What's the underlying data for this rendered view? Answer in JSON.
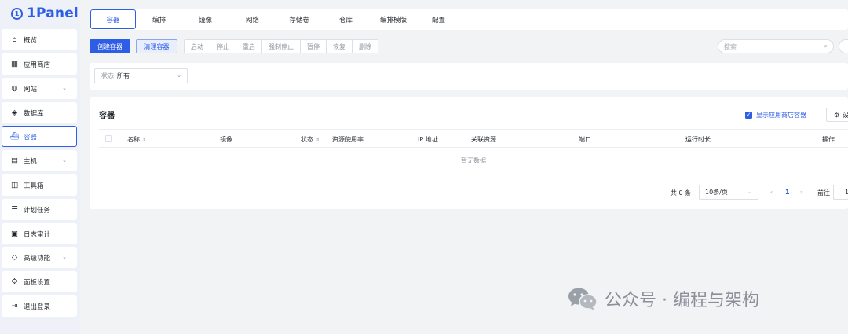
{
  "app": {
    "name": "1Panel"
  },
  "sidebar": {
    "items": [
      {
        "label": "概览",
        "icon": "home-icon",
        "glyph": "⌂"
      },
      {
        "label": "应用商店",
        "icon": "grid-icon",
        "glyph": "▦"
      },
      {
        "label": "网站",
        "icon": "globe-icon",
        "glyph": "◍",
        "expandable": true
      },
      {
        "label": "数据库",
        "icon": "database-icon",
        "glyph": "◈"
      },
      {
        "label": "容器",
        "icon": "docker-icon",
        "glyph": "⛴",
        "active": true
      },
      {
        "label": "主机",
        "icon": "server-icon",
        "glyph": "▤",
        "expandable": true
      },
      {
        "label": "工具箱",
        "icon": "toolbox-icon",
        "glyph": "◫"
      },
      {
        "label": "计划任务",
        "icon": "list-icon",
        "glyph": "☰"
      },
      {
        "label": "日志审计",
        "icon": "log-icon",
        "glyph": "▣"
      },
      {
        "label": "高级功能",
        "icon": "diamond-icon",
        "glyph": "◇",
        "expandable": true
      },
      {
        "label": "面板设置",
        "icon": "gear-icon",
        "glyph": "⚙"
      },
      {
        "label": "退出登录",
        "icon": "logout-icon",
        "glyph": "⇥"
      }
    ]
  },
  "tabs": [
    "容器",
    "编排",
    "镜像",
    "网络",
    "存储卷",
    "仓库",
    "编排模版",
    "配置"
  ],
  "toolbar": {
    "create": "创建容器",
    "clean": "清理容器",
    "group": [
      "启动",
      "停止",
      "重启",
      "强制停止",
      "暂停",
      "恢复",
      "删除"
    ],
    "search_placeholder": "搜索"
  },
  "filter": {
    "status_label": "状态",
    "status_value": "所有"
  },
  "card": {
    "title": "容器",
    "show_store_label": "显示应用商店容器",
    "settings_label": "设",
    "columns": [
      "名称",
      "镜像",
      "状态",
      "资源使用率",
      "IP 地址",
      "关联资源",
      "端口",
      "运行时长",
      "操作"
    ],
    "empty_text": "暂无数据"
  },
  "pagination": {
    "total": "共 0 条",
    "page_size": "10条/页",
    "prev": "‹",
    "page": "1",
    "next": "›",
    "goto": "前往",
    "goto_value": "1"
  },
  "watermark": {
    "text": "公众号 · 编程与架构"
  },
  "colors": {
    "primary": "#2f5ee6",
    "sidebar_bg": "#eef1f7",
    "page_bg": "#f2f3f5"
  }
}
